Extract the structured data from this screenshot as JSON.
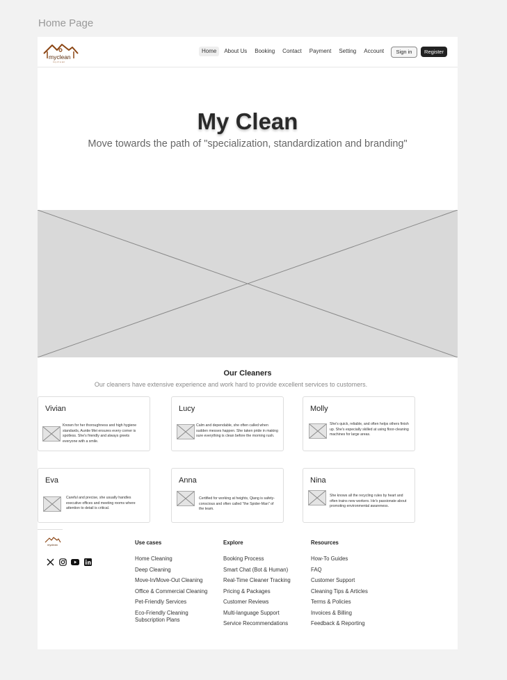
{
  "page_label": "Home Page",
  "logo": {
    "text": "myclean",
    "tagline": "myclean"
  },
  "nav": {
    "items": [
      "Home",
      "About Us",
      "Booking",
      "Contact",
      "Payment",
      "Setting",
      "Account"
    ],
    "active": "Home",
    "signin_label": "Sign in",
    "register_label": "Register"
  },
  "hero": {
    "title": "My Clean",
    "subtitle": "Move towards the path of \"specialization, standardization and branding\""
  },
  "cleaners": {
    "title": "Our Cleaners",
    "subtitle": "Our cleaners have extensive experience and work hard to provide excellent services to customers.",
    "cards": [
      {
        "name": "Vivian",
        "desc": "Known for her thoroughness and high hygiene standards, Auntie Mei ensures every corner is spotless. She's friendly and always greets everyone with a smile."
      },
      {
        "name": "Lucy",
        "desc": "Calm and dependable, she often called when sudden messes happen. She taken pride in making sure everything is clean before the morning rush."
      },
      {
        "name": "Molly",
        "desc": "She's quick, reliable, and often helps others finish up. She's especially skilled at using floor-cleaning machines for large areas."
      },
      {
        "name": "Eva",
        "desc": "Careful and precise, she usually handles executive offices and meeting rooms where attention to detail is critical."
      },
      {
        "name": "Anna",
        "desc": "Certified for working at heights, Qiang is safety-conscious and often called \"the Spider-Man\" of the team."
      },
      {
        "name": "Nina",
        "desc": "She knows all the recycling rules by heart and often trains new workers. He's passionate about promoting environmental awareness."
      }
    ]
  },
  "footer": {
    "socials": [
      "x-icon",
      "instagram-icon",
      "youtube-icon",
      "linkedin-icon"
    ],
    "columns": [
      {
        "title": "Use cases",
        "items": [
          "Home Cleaning",
          "Deep Cleaning",
          "Move-In/Move-Out Cleaning",
          "Office & Commercial Cleaning",
          "Pet-Friendly Services",
          "Eco-Friendly Cleaning",
          "Subscription Plans"
        ]
      },
      {
        "title": "Explore",
        "items": [
          "Booking Process",
          "Smart Chat (Bot & Human)",
          "Real-Time Cleaner Tracking",
          "Pricing & Packages",
          "Customer Reviews",
          "Multi-language Support",
          "Service Recommendations"
        ]
      },
      {
        "title": "Resources",
        "items": [
          "How-To Guides",
          "FAQ",
          "Customer Support",
          "Cleaning Tips & Articles",
          "Terms & Policies",
          "Invoices & Billing",
          "Feedback & Reporting"
        ]
      }
    ]
  },
  "colors": {
    "brand": "#8b4513",
    "dark": "#222222",
    "placeholder": "#d9d9d9"
  }
}
